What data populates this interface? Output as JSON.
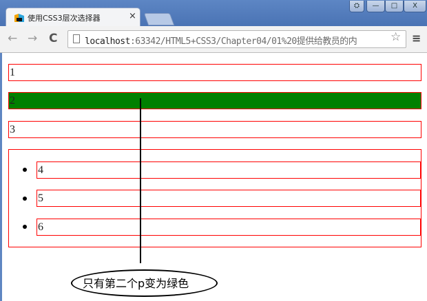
{
  "browser": {
    "tab_title": "使用CSS3层次选择器",
    "tab_close": "×",
    "url_host": "localhost",
    "url_rest": ":63342/HTML5+CSS3/Chapter04/01%20提供给教员的内",
    "window_controls": [
      "⛭",
      "—",
      "□",
      "X"
    ],
    "nav": {
      "back": "←",
      "forward": "→",
      "reload": "C"
    },
    "star_icon": "☆",
    "menu_icon": "≡"
  },
  "page": {
    "paragraphs": [
      {
        "text": "1"
      },
      {
        "text": "2",
        "highlighted": true,
        "background": "#008000"
      },
      {
        "text": "3"
      }
    ],
    "list_items": [
      "4",
      "5",
      "6"
    ],
    "border_color": "#ff0000"
  },
  "annotation": {
    "text": "只有第二个p变为绿色"
  }
}
